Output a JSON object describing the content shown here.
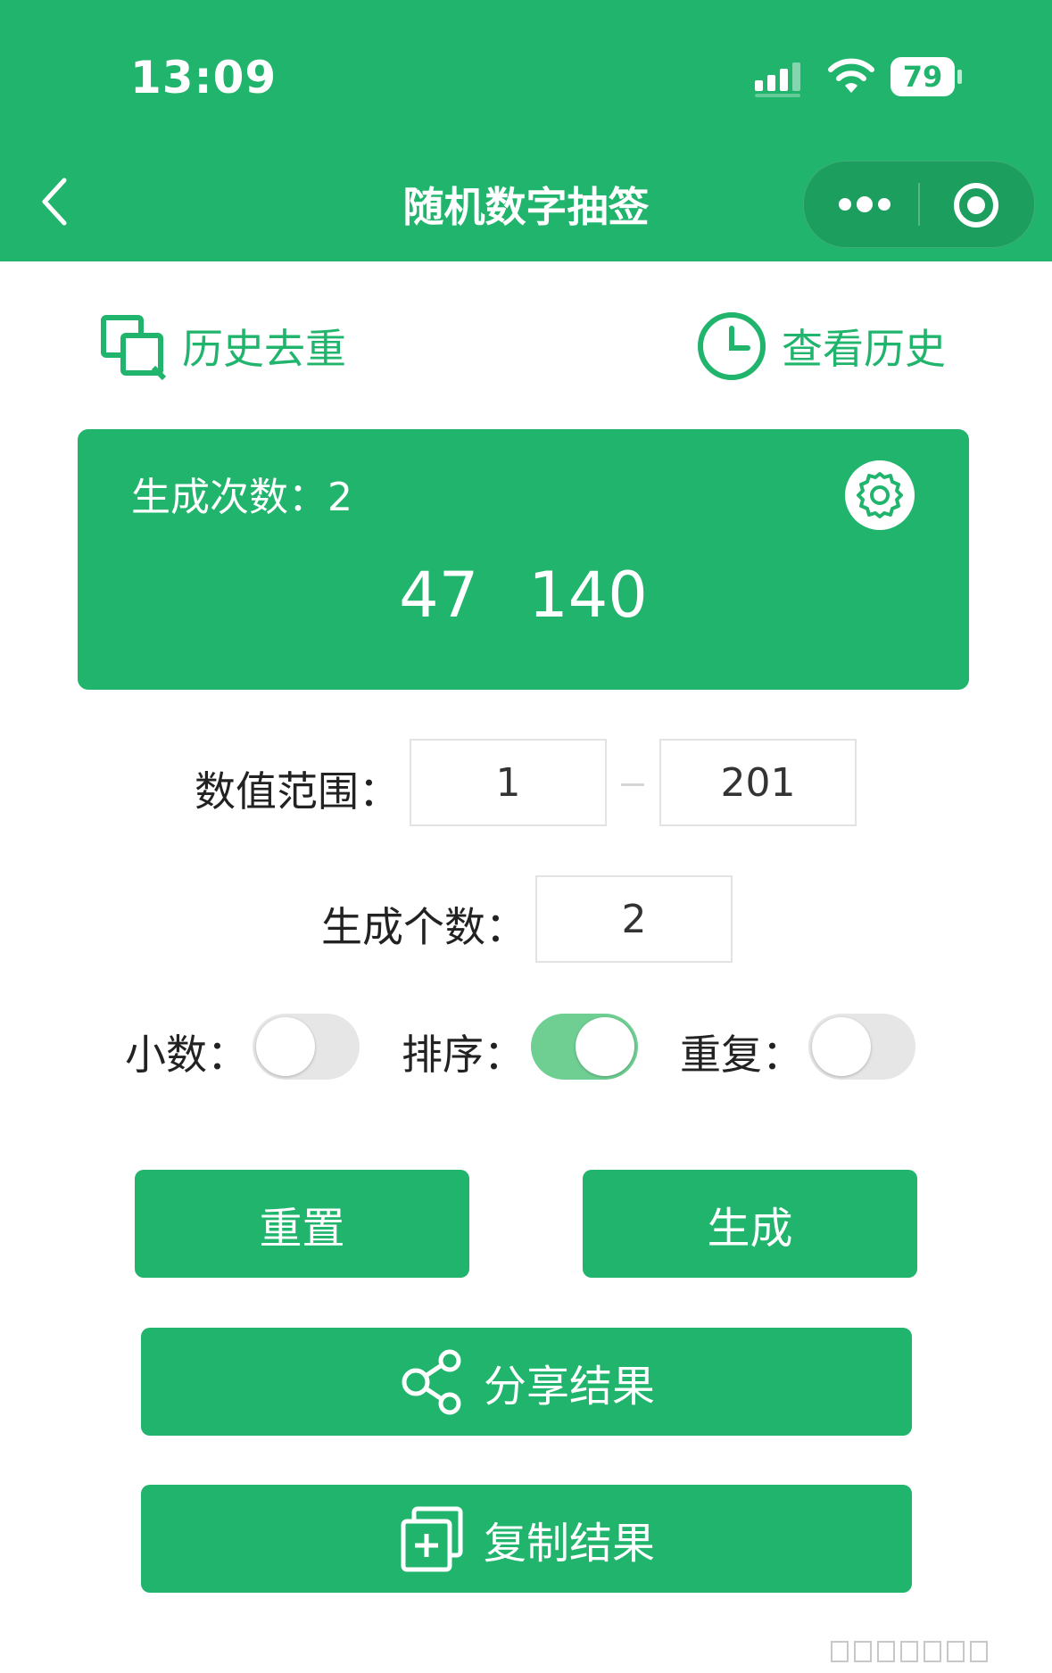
{
  "status_bar": {
    "time": "13:09",
    "battery": "79"
  },
  "nav": {
    "title": "随机数字抽签"
  },
  "links": {
    "dedupe": "历史去重",
    "history": "查看历史"
  },
  "card": {
    "count_label": "生成次数：",
    "count_value": "2",
    "results": [
      "47",
      "140"
    ]
  },
  "form": {
    "range_label": "数值范围：",
    "range_min": "1",
    "range_max": "201",
    "count_label": "生成个数：",
    "count_value": "2",
    "decimal_label": "小数：",
    "decimal_on": false,
    "sort_label": "排序：",
    "sort_on": true,
    "repeat_label": "重复：",
    "repeat_on": false
  },
  "buttons": {
    "reset": "重置",
    "generate": "生成",
    "share": "分享结果",
    "copy": "复制结果"
  },
  "colors": {
    "brand": "#20b46c",
    "toggle_on": "#6fcf93",
    "toggle_off": "#e6e6e6"
  }
}
